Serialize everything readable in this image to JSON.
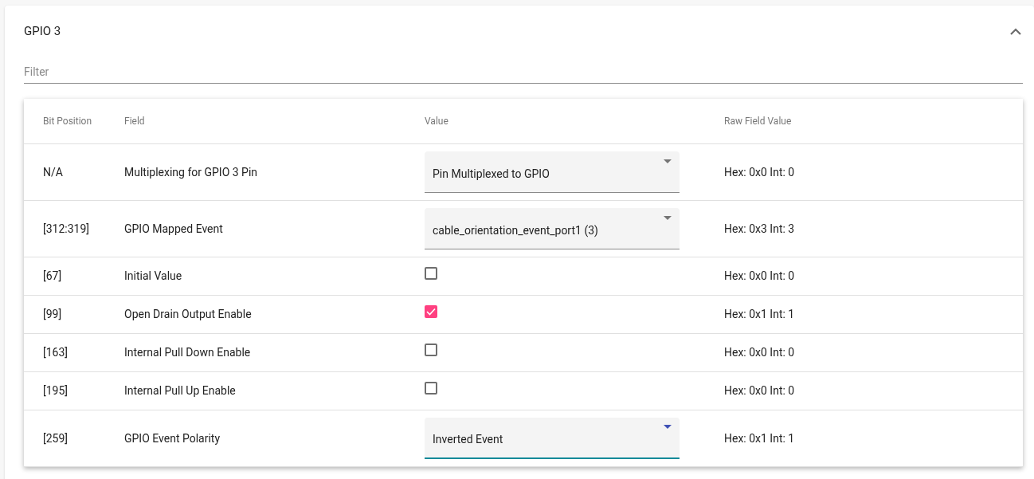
{
  "panel": {
    "title": "GPIO 3",
    "expanded": true
  },
  "filter": {
    "placeholder": "Filter"
  },
  "table": {
    "columns": [
      "Bit Position",
      "Field",
      "Value",
      "Raw Field Value"
    ],
    "rows": [
      {
        "bit": "N/A",
        "field": "Multiplexing for GPIO 3 Pin",
        "kind": "select",
        "value": "Pin Multiplexed to GPIO",
        "focused": false,
        "raw": "Hex: 0x0 Int: 0"
      },
      {
        "bit": "[312:319]",
        "field": "GPIO Mapped Event",
        "kind": "select",
        "value": "cable_orientation_event_port1 (3)",
        "focused": false,
        "raw": "Hex: 0x3 Int: 3"
      },
      {
        "bit": "[67]",
        "field": "Initial Value",
        "kind": "checkbox",
        "checked": false,
        "raw": "Hex: 0x0 Int: 0"
      },
      {
        "bit": "[99]",
        "field": "Open Drain Output Enable",
        "kind": "checkbox",
        "checked": true,
        "raw": "Hex: 0x1 Int: 1"
      },
      {
        "bit": "[163]",
        "field": "Internal Pull Down Enable",
        "kind": "checkbox",
        "checked": false,
        "raw": "Hex: 0x0 Int: 0"
      },
      {
        "bit": "[195]",
        "field": "Internal Pull Up Enable",
        "kind": "checkbox",
        "checked": false,
        "raw": "Hex: 0x0 Int: 0"
      },
      {
        "bit": "[259]",
        "field": "GPIO Event Polarity",
        "kind": "select",
        "value": "Inverted Event",
        "focused": true,
        "raw": "Hex: 0x1 Int: 1"
      }
    ]
  }
}
